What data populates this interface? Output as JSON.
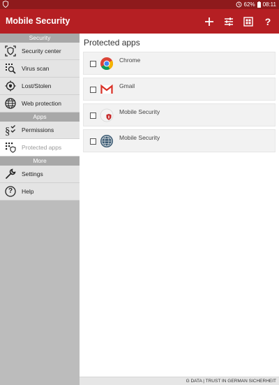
{
  "status_bar": {
    "battery": "62%",
    "time": "08:11"
  },
  "app_bar": {
    "title": "Mobile Security",
    "actions": [
      {
        "icon": "add-icon"
      },
      {
        "icon": "sliders-icon"
      },
      {
        "icon": "grid-icon"
      },
      {
        "icon": "help-icon",
        "glyph": "?"
      }
    ]
  },
  "sidebar": {
    "sections": [
      {
        "label": "Security",
        "items": [
          {
            "label": "Security center",
            "icon": "security-center-icon"
          },
          {
            "label": "Virus scan",
            "icon": "virus-scan-icon"
          },
          {
            "label": "Lost/Stolen",
            "icon": "lost-stolen-icon"
          },
          {
            "label": "Web protection",
            "icon": "globe-icon"
          }
        ]
      },
      {
        "label": "Apps",
        "items": [
          {
            "label": "Permissions",
            "icon": "permissions-icon"
          },
          {
            "label": "Protected apps",
            "icon": "protected-apps-icon",
            "active": true
          }
        ]
      },
      {
        "label": "More",
        "items": [
          {
            "label": "Settings",
            "icon": "wrench-icon"
          },
          {
            "label": "Help",
            "icon": "help-circle-icon",
            "glyph": "?"
          }
        ]
      }
    ]
  },
  "main": {
    "title": "Protected apps",
    "apps": [
      {
        "name": "Chrome",
        "icon": "chrome-icon"
      },
      {
        "name": "Gmail",
        "icon": "gmail-icon"
      },
      {
        "name": "Mobile Security",
        "icon": "mobile-security-icon"
      },
      {
        "name": "Mobile Security",
        "icon": "internet-security-icon"
      }
    ]
  },
  "footer": {
    "text": "G DATA | TRUST IN GERMAN SICHERHEIT"
  },
  "colors": {
    "status_bar": "#8e1a1c",
    "app_bar": "#b51f23",
    "sidebar": "#bcbcbc",
    "nav_item": "#e4e4e4",
    "active_item": "#ffffff"
  }
}
